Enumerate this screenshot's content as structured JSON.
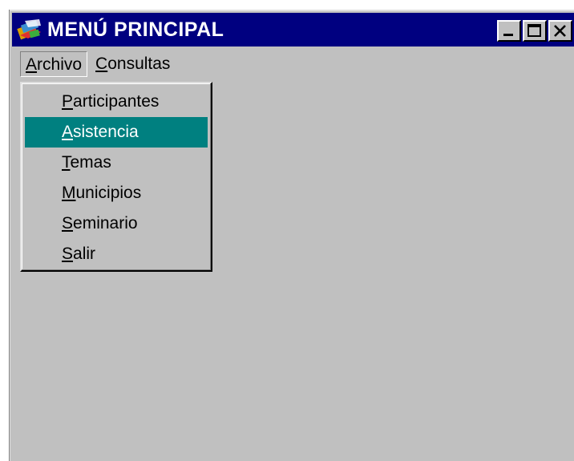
{
  "window": {
    "title": "MENÚ PRINCIPAL",
    "controls": [
      "minimize",
      "maximize",
      "close"
    ]
  },
  "menubar": {
    "items": [
      {
        "accel": "A",
        "rest": "rchivo",
        "state": "open"
      },
      {
        "accel": "C",
        "rest": "onsultas",
        "state": "closed"
      }
    ]
  },
  "dropdown": {
    "items": [
      {
        "accel": "P",
        "rest": "articipantes",
        "selected": false
      },
      {
        "accel": "A",
        "rest": "sistencia",
        "selected": true
      },
      {
        "accel": "T",
        "rest": "emas",
        "selected": false
      },
      {
        "accel": "M",
        "rest": "unicipios",
        "selected": false
      },
      {
        "accel": "S",
        "rest": "eminario",
        "selected": false
      },
      {
        "accel": "S",
        "rest": "alir",
        "selected": false
      }
    ]
  },
  "colors": {
    "titlebar": "#000080",
    "face": "#c0c0c0",
    "highlight": "#008080"
  },
  "icons": {
    "app": "app-logo-icon",
    "minimize": "minimize-icon",
    "maximize": "maximize-icon",
    "close": "close-icon"
  }
}
